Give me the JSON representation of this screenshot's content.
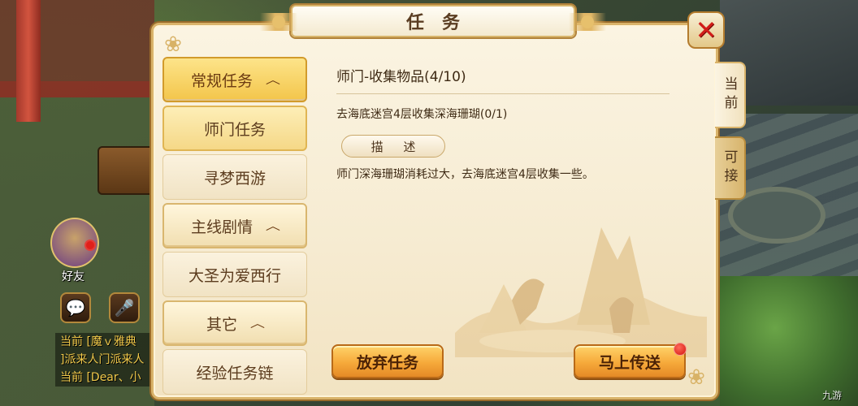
{
  "dialog": {
    "title": "任务"
  },
  "sidebar": {
    "groups": [
      {
        "label": "常规任务",
        "items": [
          {
            "label": "师门任务",
            "selected": true
          },
          {
            "label": "寻梦西游"
          }
        ]
      },
      {
        "label": "主线剧情",
        "items": [
          {
            "label": "大圣为爱西行"
          }
        ]
      },
      {
        "label": "其它",
        "items": [
          {
            "label": "经验任务链"
          }
        ]
      }
    ]
  },
  "task": {
    "title": "师门-收集物品(4/10)",
    "goal": "去海底迷宫4层收集深海珊瑚(0/1)",
    "desc_label": "描 述",
    "desc": "师门深海珊瑚消耗过大，去海底迷宫4层收集一些。"
  },
  "tabs": {
    "current": "当前",
    "available": "可接"
  },
  "buttons": {
    "abandon": "放弃任务",
    "teleport": "马上传送"
  },
  "hud": {
    "friend_label": "好友",
    "chat": [
      "当前 [魔ｖ雅典",
      "]派来人门派来人",
      "当前 [Dear、小"
    ]
  },
  "watermark": "九游"
}
